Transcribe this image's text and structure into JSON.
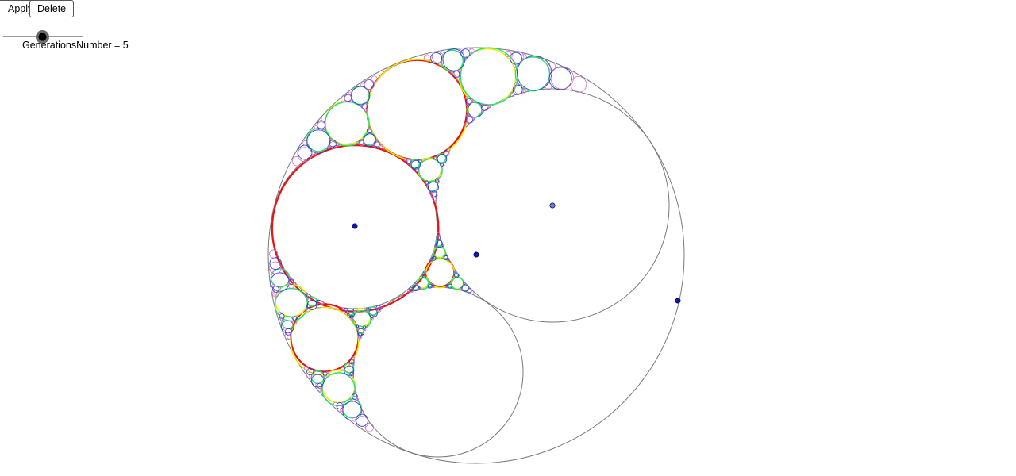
{
  "toolbar": {
    "apply_label": "Apply",
    "delete_label": "Delete"
  },
  "slider": {
    "label": "GenerationsNumber = 5",
    "value": 5,
    "min": 1,
    "max": 10
  },
  "colors": {
    "outer_circle": "#7a7a7a",
    "generation_0": "#ee1111",
    "generation_1": "#e4ef00",
    "generation_2": "#22e07a",
    "generation_3": "#2244cc",
    "generation_4": "#cc66cc",
    "control_point": "#0a1ab8",
    "control_point_light": "#6a78d8"
  },
  "icons": {
    "slider_knob": "slider-knob-icon",
    "control_point": "control-point-icon"
  }
}
